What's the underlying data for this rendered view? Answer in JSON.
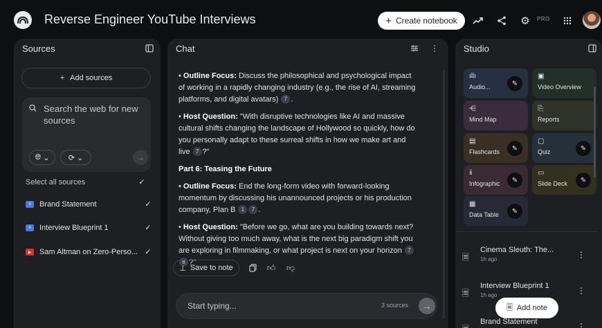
{
  "header": {
    "title": "Reverse Engineer YouTube Interviews",
    "create_label": "Create notebook",
    "pro_badge": "PRO"
  },
  "sources": {
    "title": "Sources",
    "add_label": "Add sources",
    "search_placeholder": "Search the web for new sources",
    "select_all_label": "Select all sources",
    "items": [
      {
        "name": "Brand Statement",
        "type": "doc",
        "checked": true
      },
      {
        "name": "Interview Blueprint 1",
        "type": "doc",
        "checked": true
      },
      {
        "name": "Sam Altman on Zero-Perso...",
        "type": "youtube",
        "checked": true
      }
    ]
  },
  "chat": {
    "title": "Chat",
    "p1_label": "Outline Focus:",
    "p1_text": " Discuss the philosophical and psychological impact of working in a rapidly changing industry (e.g., the rise of AI, streaming platforms, and digital avatars) ",
    "p1_cite": "7",
    "p2_label": "Host Question:",
    "p2_text": " \"With disruptive technologies like AI and massive cultural shifts changing the landscape of Hollywood so quickly, how do you personally adapt to these surreal shifts in how we make art and live ",
    "p2_cite": "7",
    "p2_end": "?\"",
    "part_heading": "Part 6: Teasing the Future",
    "p3_label": "Outline Focus:",
    "p3_text": " End the long-form video with forward-looking momentum by discussing his unannounced projects or his production company, Plan B ",
    "p3_cites": [
      "1",
      "7"
    ],
    "p4_label": "Host Question:",
    "p4_text": " \"Before we go, what are you building towards next? Without giving too much away, what is the next big paradigm shift you are exploring in filmmaking, or what project is next on your horizon ",
    "p4_cites": [
      "7",
      "8"
    ],
    "p4_end": "?\"",
    "save_label": "Save to note",
    "input_placeholder": "Start typing...",
    "sources_count": "3 sources"
  },
  "studio": {
    "title": "Studio",
    "tiles": [
      {
        "label": "Audio...",
        "icon": "audio-waveform-icon",
        "color": "#263042",
        "edit": true
      },
      {
        "label": "Video Overview",
        "icon": "video-icon",
        "color": "#23302a",
        "edit": false
      },
      {
        "label": "Mind Map",
        "icon": "mind-map-icon",
        "color": "#3a2b3d",
        "edit": false
      },
      {
        "label": "Reports",
        "icon": "reports-icon",
        "color": "#2f3226",
        "edit": false
      },
      {
        "label": "Flashcards",
        "icon": "flashcards-icon",
        "color": "#3a2f25",
        "edit": true
      },
      {
        "label": "Quiz",
        "icon": "quiz-icon",
        "color": "#25303a",
        "edit": true
      },
      {
        "label": "Infographic",
        "icon": "infographic-icon",
        "color": "#3a2a33",
        "edit": true
      },
      {
        "label": "Slide Deck",
        "icon": "slide-deck-icon",
        "color": "#33301f",
        "edit": true
      },
      {
        "label": "Data Table",
        "icon": "data-table-icon",
        "color": "#252a36",
        "edit": true
      }
    ],
    "notes": [
      {
        "title": "Cinema Sleuth: The...",
        "time": "1h ago"
      },
      {
        "title": "Interview Blueprint 1",
        "time": "1h ago"
      },
      {
        "title": "Brand Statement",
        "time": ""
      }
    ],
    "add_note_label": "Add note"
  }
}
